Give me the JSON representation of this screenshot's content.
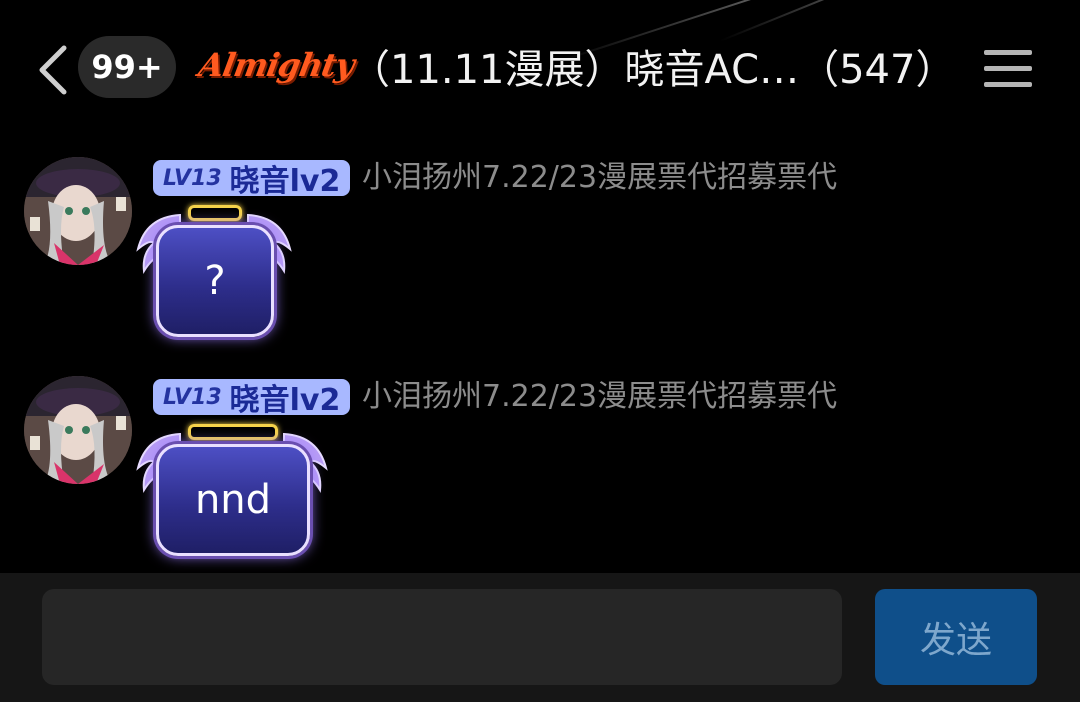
{
  "header": {
    "unread_badge": "99+",
    "logo_text": "Almighty",
    "chat_title": "（11.11漫展）晓音AC…（547）",
    "icons": [
      "back-chevron-icon",
      "hamburger-menu-icon"
    ]
  },
  "messages": [
    {
      "level": "LV13",
      "member_name": "晓音lv2",
      "sender_title": "小泪扬州7.22/23漫展票代招募票代",
      "text": "?"
    },
    {
      "level": "LV13",
      "member_name": "晓音lv2",
      "sender_title": "小泪扬州7.22/23漫展票代招募票代",
      "text": "nnd"
    }
  ],
  "composer": {
    "input_value": "",
    "send_label": "发送"
  },
  "colors": {
    "background": "#000000",
    "level_tag": "#a8b8ff",
    "bubble": "#2e2e8c",
    "send_button": "#0f4f8a",
    "logo": "#ff5a1f"
  }
}
